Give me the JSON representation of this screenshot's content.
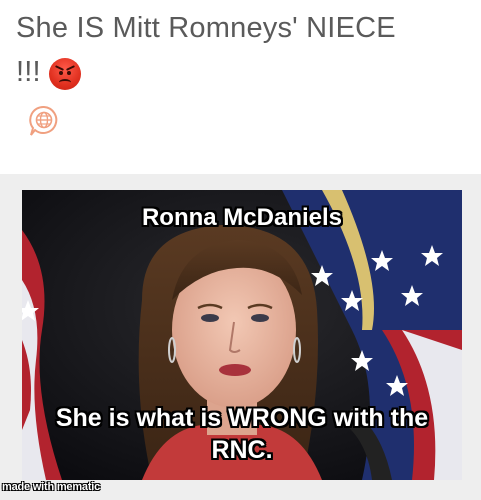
{
  "post": {
    "text_line1": "She IS Mitt Romneys' NIECE",
    "text_line2": "!!!",
    "emoji": "angry-face-icon",
    "translate_icon": "translate-globe-icon"
  },
  "meme": {
    "top_text": "Ronna McDaniels",
    "bottom_line1": "She is what is WRONG with the",
    "bottom_line2": "RNC.",
    "watermark": "made with mematic"
  },
  "colors": {
    "post_text": "#5a5a5a",
    "translate_icon": "#f0a080",
    "emoji": "#e0301f",
    "frame_bg": "#eeeeee"
  }
}
